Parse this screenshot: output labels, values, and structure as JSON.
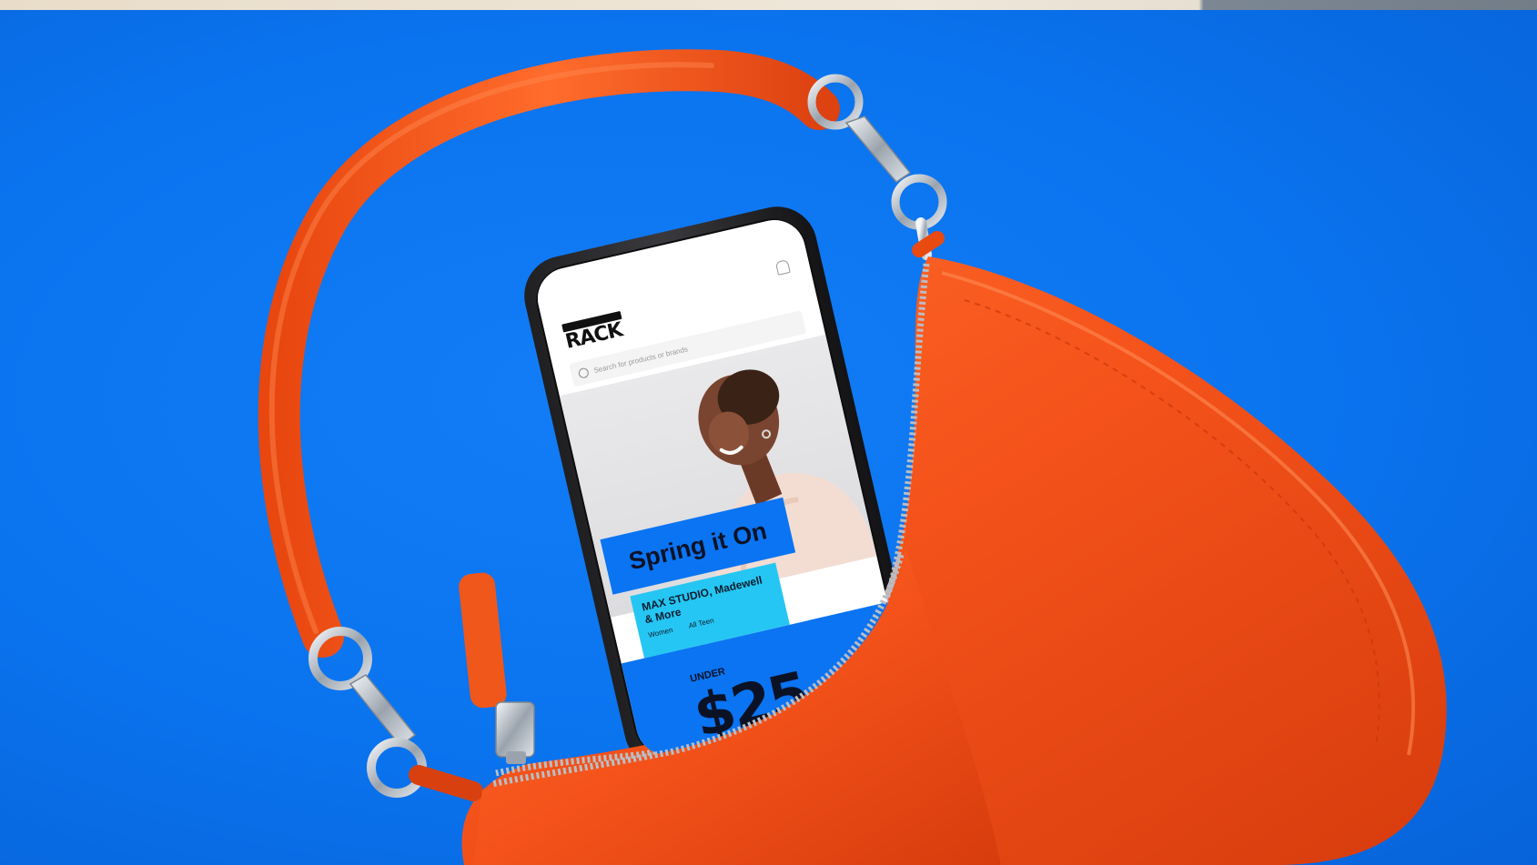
{
  "phone": {
    "logo_text": "RACK",
    "search_placeholder": "Search for products or brands",
    "banner_text": "Spring it On",
    "promo_title": "MAX STUDIO, Madewell & More",
    "promo_link_1": "Women",
    "promo_link_2": "All Teen",
    "under_label": "UNDER",
    "price_text": "$25"
  },
  "colors": {
    "background_blue": "#0a74f2",
    "bag_orange": "#f2521b",
    "promo_cyan": "#25c6f3"
  }
}
